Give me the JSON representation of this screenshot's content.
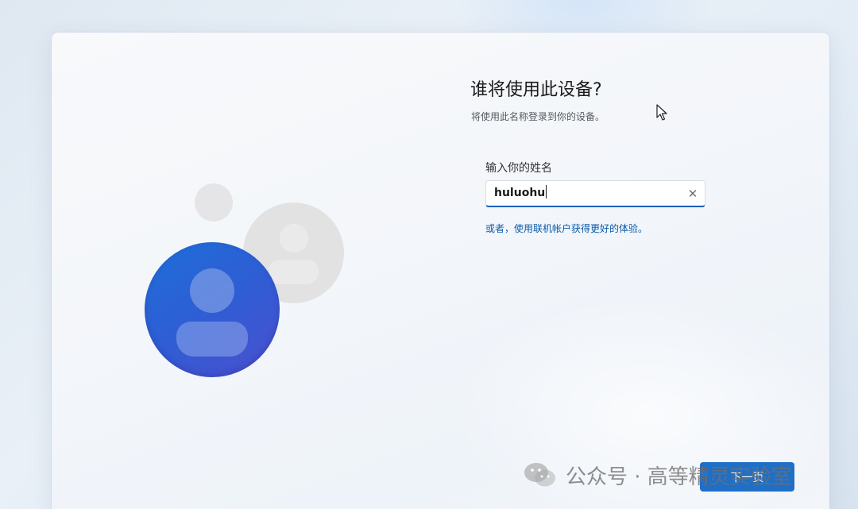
{
  "oobe": {
    "title": "谁将使用此设备?",
    "subtitle": "将使用此名称登录到你的设备。",
    "field_label": "输入你的姓名",
    "name_value": "huluohu",
    "online_account_link": "或者，使用联机帐户获得更好的体验。",
    "next_button": "下一页"
  },
  "icons": {
    "clear": "close-icon",
    "cursor": "mouse-pointer-icon",
    "watermark_logo": "wechat-icon"
  },
  "colors": {
    "accent": "#1f6fc7",
    "link": "#0a5aa8",
    "avatar_gradient_start": "#1d6fd8",
    "avatar_gradient_end": "#4b4fcf"
  },
  "watermark": {
    "text": "公众号 · 高等精灵实验室"
  }
}
